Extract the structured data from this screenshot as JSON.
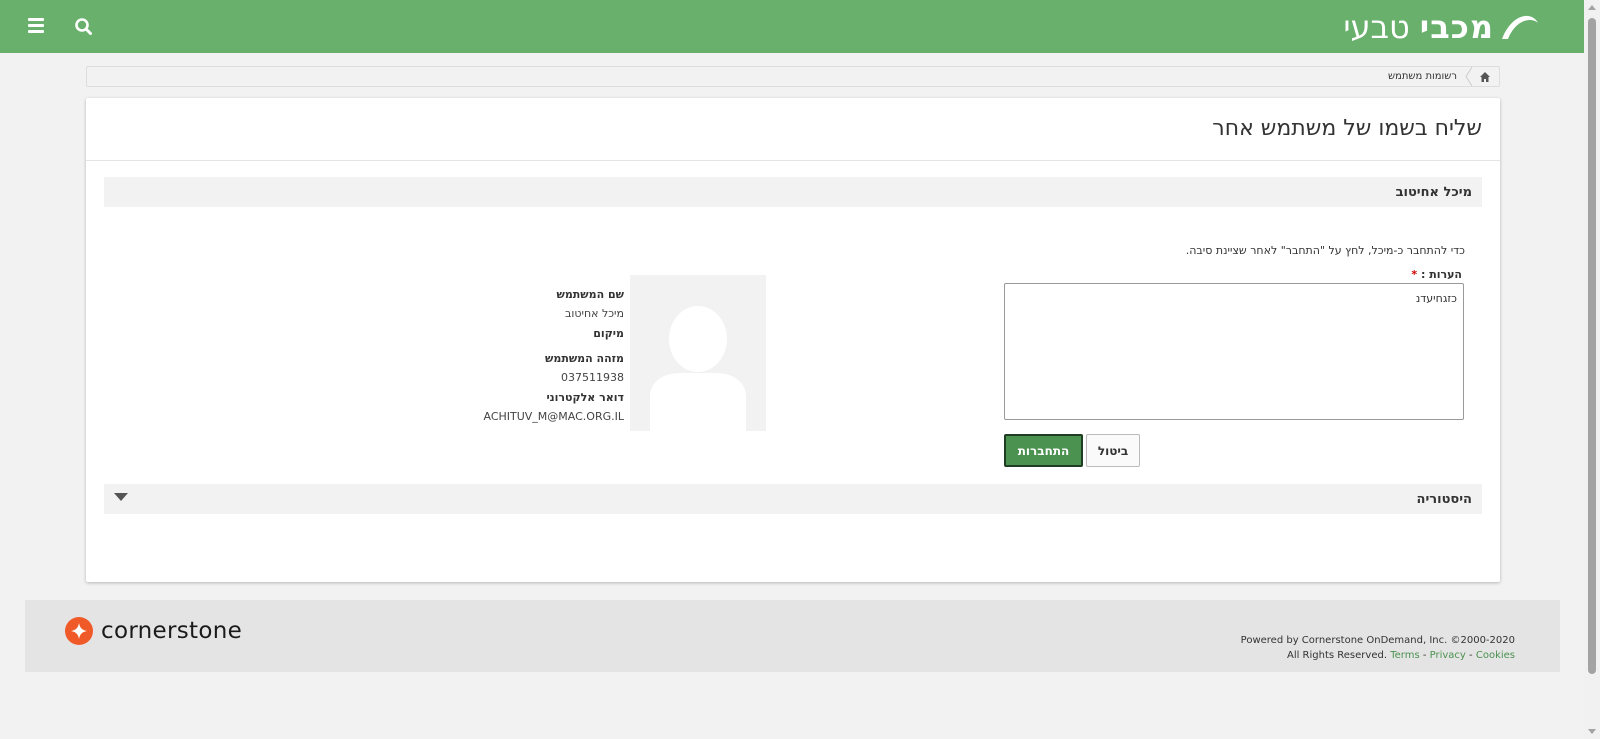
{
  "header": {
    "logo_bold": "מכבי",
    "logo_light": "טבעי",
    "menu_icon": "hamburger-icon",
    "search_icon": "search-icon"
  },
  "breadcrumb": {
    "home_icon": "home-icon",
    "current": "רשומות משתמש"
  },
  "page": {
    "title": "שליח בשמו של משתמש אחר"
  },
  "user_section": {
    "heading": "מיכל אחיטוב",
    "instructions": "כדי להתחבר כ-מיכל, לחץ על \"התחבר\" לאחר שציינת סיבה.",
    "comments_label": "הערות :",
    "required_mark": "*",
    "comments_value": "כזגחיעדנ",
    "login_button": "התחברות",
    "cancel_button": "ביטול"
  },
  "user_info": {
    "username_label": "שם המשתמש",
    "username_value": "מיכל אחיטוב",
    "location_label": "מיקום",
    "user_id_label": "מזהה המשתמש",
    "user_id_value": "037511938",
    "email_label": "דואר אלקטרוני",
    "email_value": "ACHITUV_M@MAC.ORG.IL"
  },
  "history_section": {
    "heading": "היסטוריה"
  },
  "footer": {
    "brand": "cornerstone",
    "powered": "Powered by Cornerstone OnDemand, Inc. ©2000-2020",
    "rights": "All Rights Reserved.",
    "terms": "Terms",
    "privacy": "Privacy",
    "cookies": "Cookies",
    "sep": "-"
  },
  "colors": {
    "header_green": "#68b06c",
    "button_green": "#4b9150",
    "cornerstone_orange": "#f05a28"
  }
}
